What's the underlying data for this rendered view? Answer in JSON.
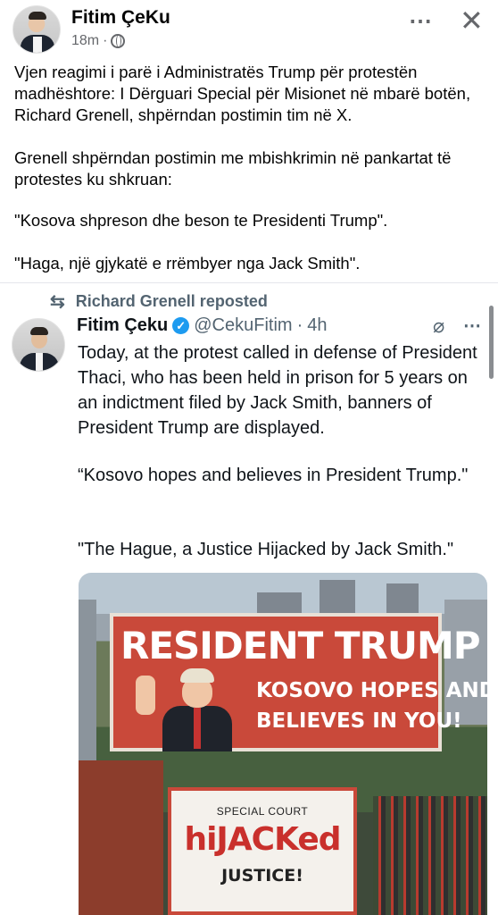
{
  "post": {
    "author": "Fitim ÇeKu",
    "time": "18m",
    "dot": "·",
    "paragraphs": [
      "Vjen reagimi i parë i Administratës Trump për protestën madhështore: I Dërguari Special për Misionet në mbarë botën, Richard Grenell, shpërndan postimin tim në X.",
      "Grenell shpërndan postimin me mbishkrimin në pankartat të protestes ku shkruan:",
      " \"Kosova shpreson dhe beson te Presidenti Trump\".",
      "\"Haga, një gjykatë e rrëmbyer nga Jack Smith\"."
    ]
  },
  "icons": {
    "more": "⋯",
    "close": "✕",
    "repost": "⇆",
    "verified": "✓",
    "grok": "⌀",
    "x_more": "⋯"
  },
  "embed": {
    "reposted_by": "Richard Grenell reposted",
    "name": "Fitim Çeku",
    "handle": "@CekuFitim",
    "time": "4h",
    "dot": "·",
    "paragraphs": [
      "Today, at the protest called in defense of President Thaci, who has been held in prison for 5 years on an indictment filed by Jack Smith, banners of President Trump are displayed.",
      "“Kosovo hopes and believes in President Trump.\"",
      "\"The Hague, a Justice Hijacked by Jack Smith.\""
    ]
  },
  "photo": {
    "banner1_title": "RESIDENT TRUMP",
    "banner1_line1": "KOSOVO HOPES AND",
    "banner1_line2": "BELIEVES IN YOU!",
    "banner2_sub": "SPECIAL COURT",
    "banner2_main": "hiJACKed",
    "banner2_bottom": "JUSTICE!"
  }
}
